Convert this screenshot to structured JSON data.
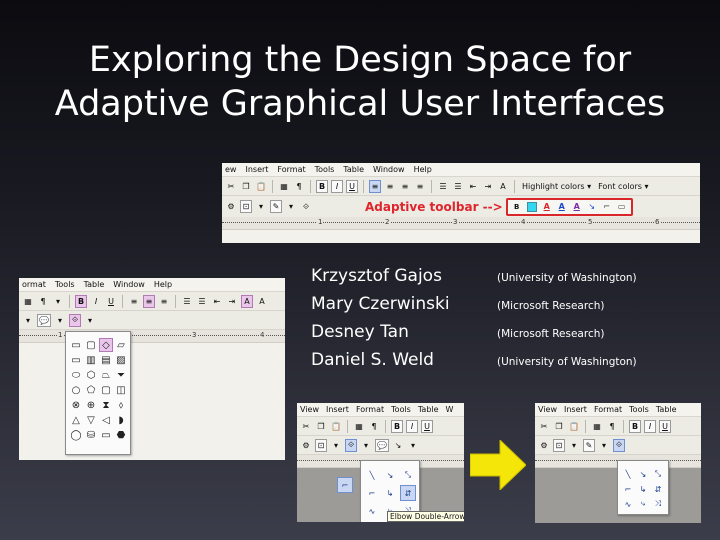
{
  "title": {
    "line1": "Exploring the Design Space for",
    "line2": "Adaptive Graphical User Interfaces"
  },
  "authors": [
    {
      "name": "Krzysztof Gajos",
      "affiliation": "(University of Washington)"
    },
    {
      "name": "Mary Czerwinski",
      "affiliation": "(Microsoft Research)"
    },
    {
      "name": "Desney Tan",
      "affiliation": "(Microsoft Research)"
    },
    {
      "name": "Daniel S. Weld",
      "affiliation": "(University of Washington)"
    }
  ],
  "top_screenshot": {
    "menu": [
      "ew",
      "Insert",
      "Format",
      "Tools",
      "Table",
      "Window",
      "Help"
    ],
    "highlight_colors": "Highlight colors ▾",
    "font_colors": "Font colors ▾",
    "adaptive_label": "Adaptive toolbar -->",
    "ruler_numbers": [
      "1",
      "2",
      "3",
      "4",
      "5",
      "6"
    ]
  },
  "left_screenshot": {
    "menu": [
      "ormat",
      "Tools",
      "Table",
      "Window",
      "Help"
    ],
    "ruler_numbers": [
      "1",
      "3",
      "4"
    ]
  },
  "bottom_left_screenshot": {
    "menu": [
      "View",
      "Insert",
      "Format",
      "Tools",
      "Table",
      "W"
    ],
    "tooltip": "Elbow Double-Arrow"
  },
  "bottom_right_screenshot": {
    "menu": [
      "View",
      "Insert",
      "Format",
      "Tools",
      "Table"
    ]
  },
  "colors": {
    "adaptive_red": "#e0242c",
    "arrow_yellow": "#f5e60a"
  }
}
